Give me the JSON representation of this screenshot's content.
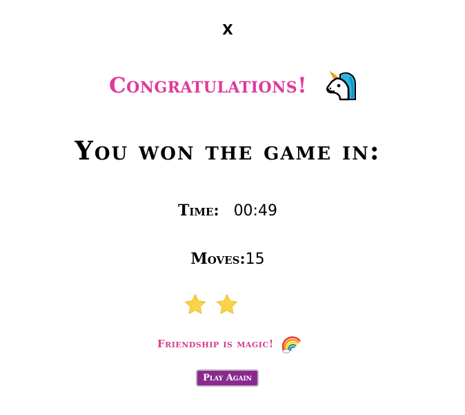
{
  "modal": {
    "close_label": "X",
    "congrats_text": "Congratulations!",
    "won_text": "You won the game in:",
    "time_label": "Time:",
    "time_value": "00:49",
    "moves_label": "Moves:",
    "moves_value": "15",
    "stars_earned": 2,
    "star_icon": "star-icon",
    "unicorn_icon": "unicorn-icon",
    "rainbow_icon": "rainbow-icon",
    "magic_text": "Friendship is magic!",
    "play_again_label": "Play Again"
  },
  "colors": {
    "congrats": "#e0399b",
    "magic": "#d53c8f",
    "button": "#8a2a8f",
    "star": "#f9d448"
  }
}
